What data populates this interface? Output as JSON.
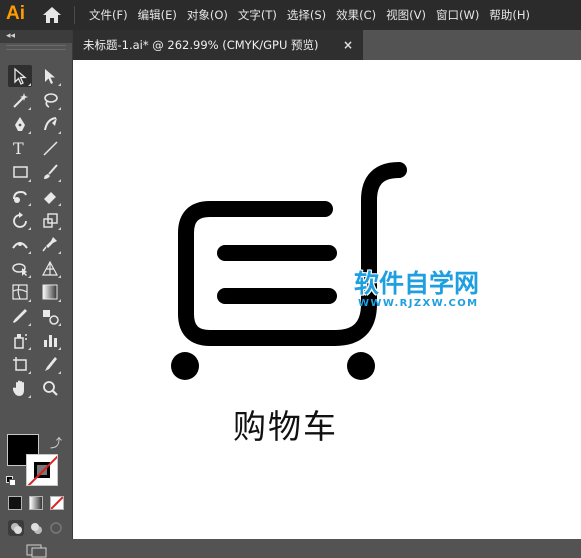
{
  "app": {
    "logo": "Ai"
  },
  "menu": [
    "文件(F)",
    "编辑(E)",
    "对象(O)",
    "文字(T)",
    "选择(S)",
    "效果(C)",
    "视图(V)",
    "窗口(W)",
    "帮助(H)"
  ],
  "document_tab": {
    "title": "未标题-1.ai* @ 262.99% (CMYK/GPU 预览)",
    "close": "×"
  },
  "toolbar": {
    "collapse": "◂◂",
    "tools": [
      [
        "selection-tool-icon",
        "direct-selection-tool-icon"
      ],
      [
        "magic-wand-tool-icon",
        "lasso-tool-icon"
      ],
      [
        "pen-tool-icon",
        "curvature-tool-icon"
      ],
      [
        "type-tool-icon",
        "line-segment-tool-icon"
      ],
      [
        "rectangle-tool-icon",
        "paintbrush-tool-icon"
      ],
      [
        "shaper-tool-icon",
        "eraser-tool-icon"
      ],
      [
        "rotate-tool-icon",
        "scale-tool-icon"
      ],
      [
        "width-tool-icon",
        "puppet-warp-tool-icon"
      ],
      [
        "shape-builder-tool-icon",
        "perspective-grid-tool-icon"
      ],
      [
        "mesh-tool-icon",
        "gradient-tool-icon"
      ],
      [
        "eyedropper-tool-icon",
        "blend-tool-icon"
      ],
      [
        "symbol-sprayer-tool-icon",
        "column-graph-tool-icon"
      ],
      [
        "artboard-tool-icon",
        "slice-tool-icon"
      ],
      [
        "hand-tool-icon",
        "zoom-tool-icon"
      ]
    ],
    "swap_glyph": "⤴",
    "colors": {
      "fill": "#000000",
      "stroke": "#ffffff",
      "ui_bg": "#535353",
      "menubar": "#2b2b2b"
    }
  },
  "canvas": {
    "caption": "购物车",
    "watermark_title": "软件自学网",
    "watermark_url": "WWW.RJZXW.COM"
  }
}
